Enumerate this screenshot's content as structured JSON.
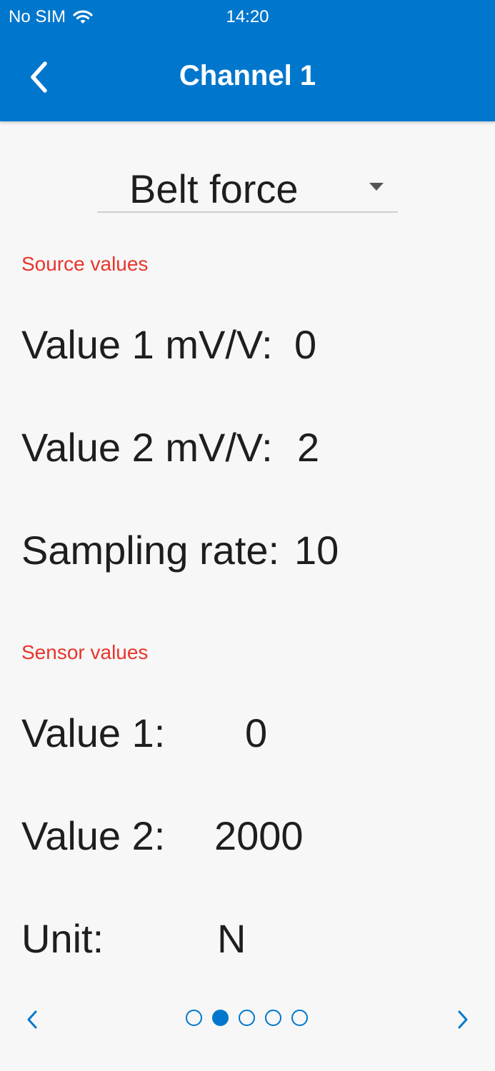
{
  "status_bar": {
    "carrier": "No SIM",
    "time": "14:20"
  },
  "header": {
    "title": "Channel 1"
  },
  "selector": {
    "value": "Belt force"
  },
  "source_section": {
    "label": "Source values",
    "rows": [
      {
        "label": "Value 1 mV/V:",
        "value": "0"
      },
      {
        "label": "Value 2 mV/V:",
        "value": "2"
      },
      {
        "label": "Sampling rate:",
        "value": "10"
      }
    ]
  },
  "sensor_section": {
    "label": "Sensor values",
    "rows": [
      {
        "label": "Value 1:",
        "value": "0"
      },
      {
        "label": "Value 2:",
        "value": "2000"
      },
      {
        "label": "Unit:",
        "value": "N"
      }
    ]
  },
  "pager": {
    "page_count": 5,
    "active_index": 1
  },
  "colors": {
    "accent": "#0077cc",
    "section_label": "#e8352b",
    "background": "#f7f7f7"
  }
}
